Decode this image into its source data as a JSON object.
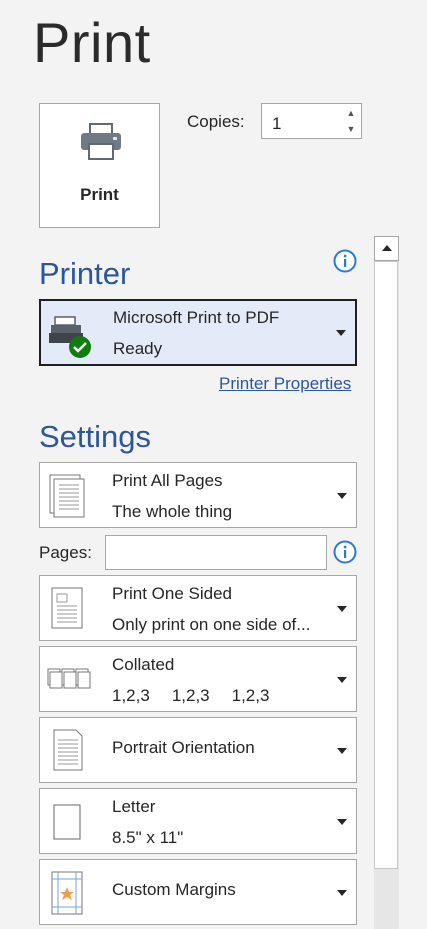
{
  "page": {
    "title": "Print"
  },
  "print_button": {
    "label": "Print",
    "icon": "printer-icon"
  },
  "copies": {
    "label": "Copies:",
    "value": "1"
  },
  "printer": {
    "section_title": "Printer",
    "name": "Microsoft Print to PDF",
    "status": "Ready",
    "properties_link": "Printer Properties"
  },
  "settings": {
    "section_title": "Settings",
    "pages_label": "Pages:",
    "pages_value": "",
    "print_range": {
      "line1": "Print All Pages",
      "line2": "The whole thing"
    },
    "sides": {
      "line1": "Print One Sided",
      "line2": "Only print on one side of..."
    },
    "collation": {
      "line1": "Collated",
      "values": [
        "1,2,3",
        "1,2,3",
        "1,2,3"
      ]
    },
    "orientation": {
      "line1": "Portrait Orientation"
    },
    "paper": {
      "line1": "Letter",
      "line2": "8.5\" x 11\""
    },
    "margins": {
      "line1": "Custom Margins"
    }
  },
  "colors": {
    "accent": "#2b579a",
    "selected_bg": "#e3ebf8",
    "ok_green": "#107c10"
  }
}
